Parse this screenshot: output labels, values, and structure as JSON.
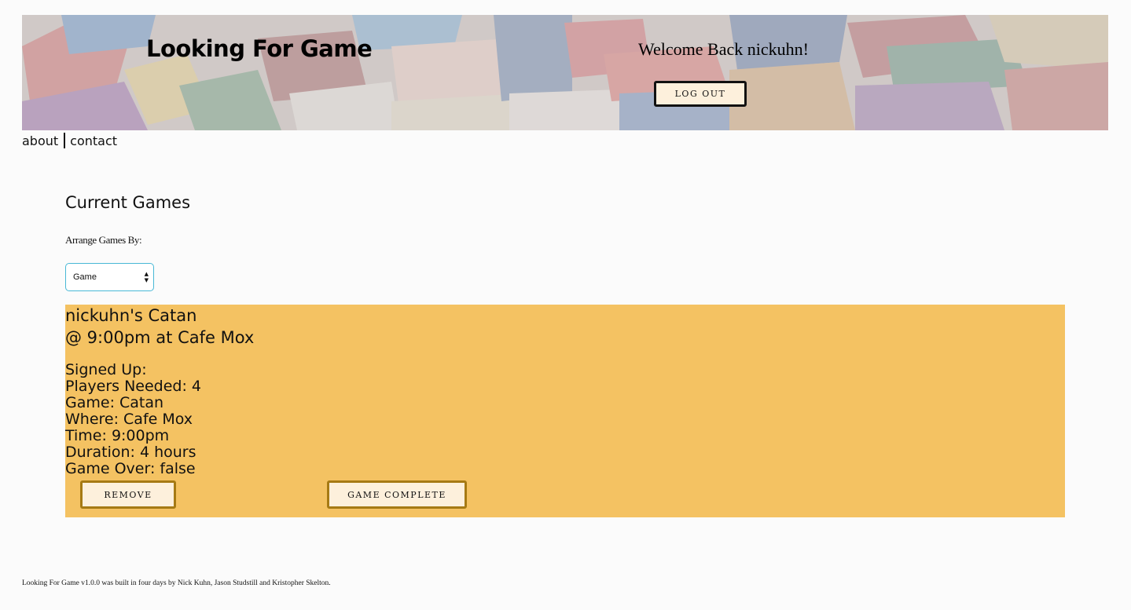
{
  "header": {
    "site_title": "Looking For Game",
    "welcome_text": "Welcome Back nickuhn!",
    "logout_label": "LOG OUT"
  },
  "nav": {
    "items": [
      {
        "label": "about"
      },
      {
        "label": "contact"
      }
    ]
  },
  "main": {
    "section_title": "Current Games",
    "arrange_label": "Arrange Games By:",
    "arrange_select": {
      "selected": "Game"
    }
  },
  "game_card": {
    "title_line": "nickuhn's Catan",
    "subtitle_line": "@ 9:00pm at Cafe Mox",
    "details": [
      {
        "text": "Signed Up:"
      },
      {
        "text": "Players Needed: 4"
      },
      {
        "text": "Game: Catan"
      },
      {
        "text": "Where: Cafe Mox"
      },
      {
        "text": "Time: 9:00pm"
      },
      {
        "text": "Duration: 4 hours"
      },
      {
        "text": "Game Over: false"
      }
    ],
    "remove_label": "REMOVE",
    "complete_label": "GAME COMPLETE"
  },
  "footer": {
    "text": "Looking For Game v1.0.0 was built in four days by Nick Kuhn, Jason Studstill and Kristopher Skelton."
  },
  "colors": {
    "page_background": "#fbfbfb",
    "card_background": "#f4c262",
    "button_fill": "#fdf0dc",
    "card_button_border": "#a67a14",
    "select_border": "#48b8d6"
  },
  "icons": {
    "select_arrows": "updown-arrows-icon"
  }
}
